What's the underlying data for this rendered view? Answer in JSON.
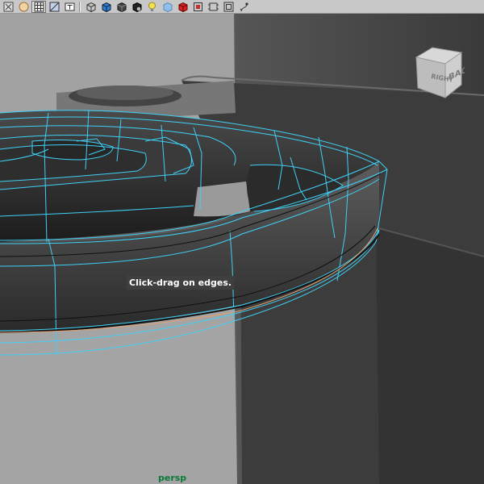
{
  "toolbar": {
    "buttons": [
      {
        "icon": "selection-highlight-icon"
      },
      {
        "icon": "default-material-icon"
      },
      {
        "icon": "wireframe-grid-icon",
        "active": true
      },
      {
        "icon": "textured-icon"
      },
      {
        "icon": "ui-text-icon"
      },
      {
        "icon": "separator"
      },
      {
        "icon": "bounding-box-icon"
      },
      {
        "icon": "smooth-shade-icon"
      },
      {
        "icon": "shadow-icon"
      },
      {
        "icon": "xray-icon"
      },
      {
        "icon": "light-bulb-icon"
      },
      {
        "icon": "hardware-texture-icon"
      },
      {
        "icon": "use-default-material-icon"
      },
      {
        "icon": "isolate-select-icon"
      },
      {
        "icon": "frame-selection-icon"
      },
      {
        "icon": "resolution-gate-icon"
      },
      {
        "icon": "camera-attributes-icon"
      }
    ]
  },
  "viewport": {
    "tooltip": "Click-drag on edges.",
    "camera_label": "persp",
    "viewcube": {
      "front_face": "BACK",
      "side_face": "RIGHT"
    }
  },
  "colors": {
    "wireframe": "#3fd0f5",
    "selected_edge": "#e0a070",
    "camera_label": "#0a7a3a"
  }
}
